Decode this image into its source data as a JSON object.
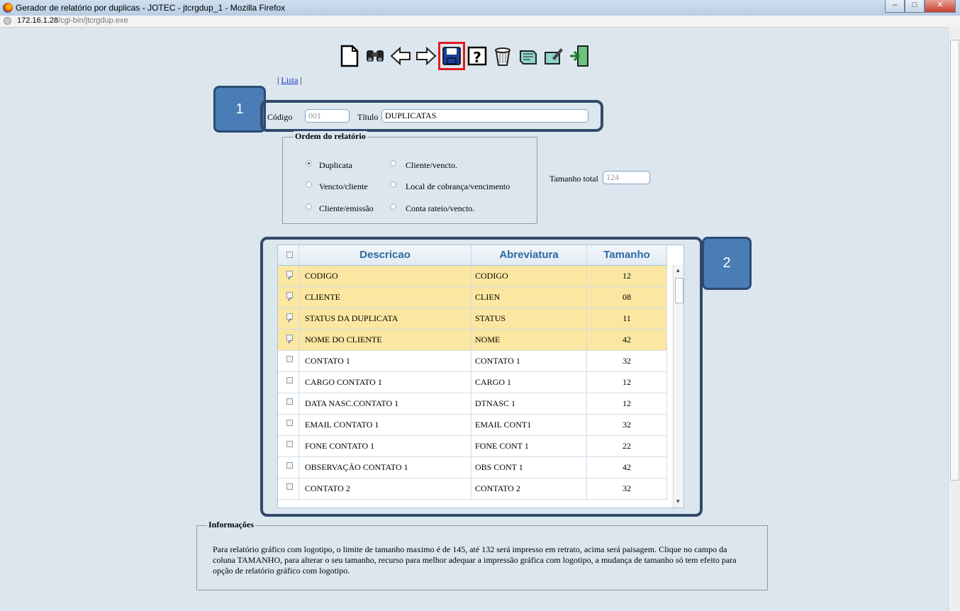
{
  "window": {
    "title": "Gerador de relatório por duplicas - JOTEC - jtcrgdup_1 - Mozilla Firefox",
    "url_host": "172.16.1.28",
    "url_path": "/cgi-bin/jtcrgdup.exe"
  },
  "toolbar": {
    "icons": [
      "new-icon",
      "search-icon",
      "back-icon",
      "forward-icon",
      "save-icon",
      "help-icon",
      "delete-icon",
      "notes-icon",
      "edit-icon",
      "exit-icon"
    ],
    "highlighted": "save-icon"
  },
  "nav": {
    "lista": "Lista",
    "sep_left": "|",
    "sep_right": "|"
  },
  "callouts": {
    "one": "1",
    "two": "2"
  },
  "form": {
    "codigo_label": "Código",
    "codigo_value": "001",
    "titulo_label": "Título",
    "titulo_value": "DUPLICATAS",
    "tamanho_total_label": "Tamanho total",
    "tamanho_total_value": "124"
  },
  "ordem": {
    "legend": "Ordem do relatório",
    "options": [
      "Duplicata",
      "Cliente/vencto.",
      "Vencto/cliente",
      "Local de cobrança/vencimento",
      "Cliente/emissão",
      "Conta rateio/vencto."
    ],
    "selected": "Duplicata"
  },
  "grid": {
    "headers": {
      "descricao": "Descricao",
      "abreviatura": "Abreviatura",
      "tamanho": "Tamanho"
    },
    "rows": [
      {
        "checked": true,
        "descricao": "CODIGO",
        "abreviatura": "CODIGO",
        "tamanho": "12"
      },
      {
        "checked": true,
        "descricao": "CLIENTE",
        "abreviatura": "CLIEN",
        "tamanho": "08"
      },
      {
        "checked": true,
        "descricao": "STATUS DA DUPLICATA",
        "abreviatura": "STATUS",
        "tamanho": "11"
      },
      {
        "checked": true,
        "descricao": "NOME DO CLIENTE",
        "abreviatura": "NOME",
        "tamanho": "42"
      },
      {
        "checked": false,
        "descricao": "CONTATO 1",
        "abreviatura": "CONTATO 1",
        "tamanho": "32"
      },
      {
        "checked": false,
        "descricao": "CARGO CONTATO 1",
        "abreviatura": "CARGO 1",
        "tamanho": "12"
      },
      {
        "checked": false,
        "descricao": "DATA NASC.CONTATO 1",
        "abreviatura": "DTNASC 1",
        "tamanho": "12"
      },
      {
        "checked": false,
        "descricao": "EMAIL CONTATO 1",
        "abreviatura": "EMAIL CONT1",
        "tamanho": "32"
      },
      {
        "checked": false,
        "descricao": "FONE CONTATO 1",
        "abreviatura": "FONE CONT 1",
        "tamanho": "22"
      },
      {
        "checked": false,
        "descricao": "OBSERVAÇÃO CONTATO 1",
        "abreviatura": "OBS CONT 1",
        "tamanho": "42"
      },
      {
        "checked": false,
        "descricao": "CONTATO 2",
        "abreviatura": "CONTATO 2",
        "tamanho": "32"
      }
    ]
  },
  "info": {
    "legend": "Informações",
    "text": "Para relatório gráfico com logotipo, o limite de tamanho maximo é de 145, até 132 será impresso em retrato, acima será paisagem. Clique no campo da coluna TAMANHO, para alterar o seu tamanho, recurso para melhor adequar a impressão gráfica com logotipo, a mudança de tamanho só tem efeito para opção de relatório gráfico com logotipo."
  },
  "colors": {
    "highlight_row": "#fbe7a1",
    "header_text": "#2d6aa3",
    "callout": "#4a7cb5",
    "frame": "#314a6b",
    "save_highlight": "#e41b1b"
  }
}
